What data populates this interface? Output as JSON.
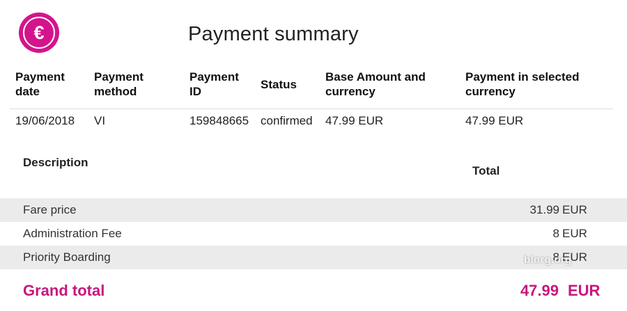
{
  "logo": {
    "symbol": "€",
    "icon": "euro-icon",
    "color": "#d4148c"
  },
  "title": "Payment summary",
  "payment_table": {
    "headers": {
      "date": [
        "Payment",
        "date"
      ],
      "method": [
        "Payment",
        "method"
      ],
      "id": [
        "Payment",
        "ID"
      ],
      "status": "Status",
      "base": [
        "Base Amount and",
        "currency"
      ],
      "selected": [
        "Payment in selected",
        "currency"
      ]
    },
    "row": {
      "date": "19/06/2018",
      "method": "VI",
      "id": "159848665",
      "status": "confirmed",
      "base": "47.99 EUR",
      "selected": "47.99 EUR"
    }
  },
  "breakdown": {
    "description_header": "Description",
    "total_header": "Total",
    "items": [
      {
        "label": "Fare price",
        "amount": "31.99",
        "currency": "EUR"
      },
      {
        "label": "Administration Fee",
        "amount": "8",
        "currency": "EUR"
      },
      {
        "label": "Priority Boarding",
        "amount": "8",
        "currency": "EUR"
      }
    ]
  },
  "grand_total": {
    "label": "Grand total",
    "amount": "47.99",
    "currency": "EUR",
    "color": "#c8167e"
  },
  "watermark": "blorg.org"
}
